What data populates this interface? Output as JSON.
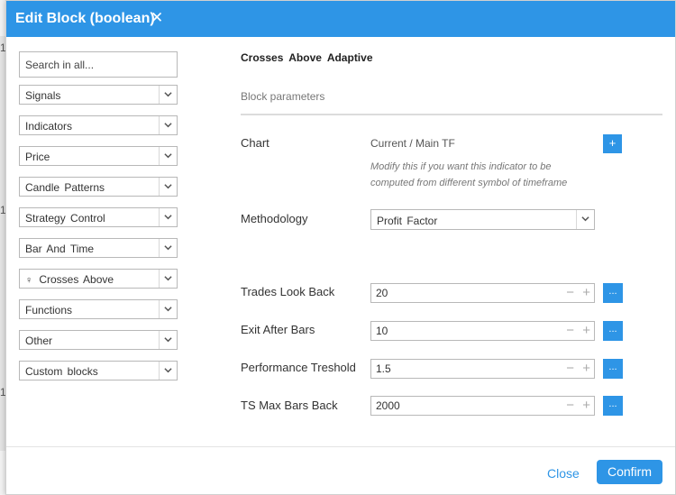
{
  "dialog": {
    "title": "Edit Block (boolean)",
    "close_glyph": "✕"
  },
  "background": {
    "marks": [
      "1",
      "1",
      "1"
    ]
  },
  "sidebar": {
    "search_placeholder": "Search in all...",
    "categories": [
      {
        "label": "Signals"
      },
      {
        "label": "Indicators"
      },
      {
        "label": "Price"
      },
      {
        "label": "Candle Patterns"
      },
      {
        "label": "Strategy Control"
      },
      {
        "label": "Bar And Time"
      },
      {
        "label": "Crosses Above",
        "icon": "pin-icon",
        "icon_glyph": "♀"
      },
      {
        "label": "Functions"
      },
      {
        "label": "Other"
      },
      {
        "label": "Custom blocks"
      }
    ]
  },
  "main": {
    "block_title": "Crosses Above Adaptive",
    "section": "Block parameters",
    "chart": {
      "label": "Chart",
      "value": "Current / Main TF",
      "button_glyph": "+",
      "hint": "Modify this if you want this indicator to be computed from different symbol of timeframe"
    },
    "methodology": {
      "label": "Methodology",
      "selected": "Profit Factor"
    },
    "params": [
      {
        "label": "Trades Look Back",
        "value": "20"
      },
      {
        "label": "Exit After Bars",
        "value": "10"
      },
      {
        "label": "Performance Treshold",
        "value": "1.5"
      },
      {
        "label": "TS Max Bars Back",
        "value": "2000"
      }
    ],
    "stepper": {
      "minus": "−",
      "plus": "+"
    },
    "dots_glyph": "..."
  },
  "footer": {
    "close_label": "Close",
    "confirm_label": "Confirm"
  },
  "colors": {
    "accent": "#2e95e6",
    "border": "#b8b8b8"
  }
}
